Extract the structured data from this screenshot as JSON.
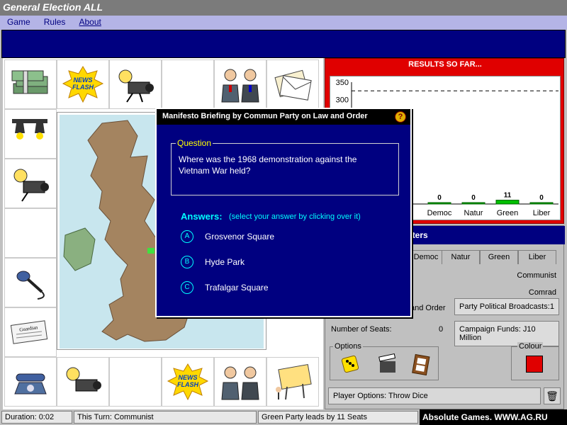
{
  "window": {
    "title": "General Election ALL"
  },
  "menu": [
    {
      "label": "Game"
    },
    {
      "label": "Rules"
    },
    {
      "label": "About"
    }
  ],
  "results": {
    "title": "RESULTS SO FAR..."
  },
  "chart_data": {
    "type": "bar",
    "categories": [
      "Democ",
      "Natur",
      "Green",
      "Liber"
    ],
    "values": [
      0,
      0,
      11,
      0
    ],
    "colors": [
      "#00a000",
      "#00a000",
      "#00c000",
      "#00a000"
    ],
    "yticks": [
      "350",
      "300"
    ],
    "ylim": [
      0,
      350
    ],
    "reference_line": 325
  },
  "hq": {
    "title": "Campaign Headquarters",
    "tabs": [
      {
        "label": "Democ"
      },
      {
        "label": "Natur"
      },
      {
        "label": "Green"
      },
      {
        "label": "Liber"
      }
    ],
    "party_name": "Communist",
    "leader": "Comrad",
    "policy_fragment": "and Order",
    "broadcasts_label": "Party Political Broadcasts:",
    "broadcasts_value": "1",
    "seats_label": "Number of Seats:",
    "seats_value": "0",
    "funds_label": "Campaign Funds:",
    "funds_value": "J10 Million",
    "options_label": "Options",
    "colour_label": "Colour",
    "player_options": "Player Options: Throw Dice",
    "party_colour": "#e00000"
  },
  "status": {
    "duration": "Duration:  0:02",
    "turn": "This Turn: Communist",
    "leader_msg": "Green Party leads by 11 Seats"
  },
  "watermark": "Absolute Games. WWW.AG.RU",
  "dialog": {
    "title": "Manifesto Briefing by Commun Party on Law and Order",
    "help": "?",
    "question_label": "Question",
    "question_line1": "Where was the 1968 demonstration against the",
    "question_line2": "Vietnam War held?",
    "answers_label": "Answers:",
    "answers_hint": "(select your answer by clicking over it)",
    "answers": [
      {
        "key": "A",
        "text": "Grosvenor Square"
      },
      {
        "key": "B",
        "text": "Hyde Park"
      },
      {
        "key": "C",
        "text": "Trafalgar Square"
      }
    ]
  },
  "board": {
    "newsflash": "NEWS FLASH",
    "newspaper": "Guardian"
  }
}
